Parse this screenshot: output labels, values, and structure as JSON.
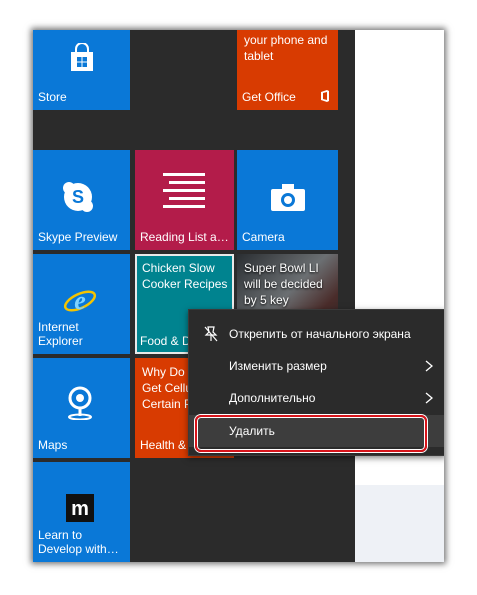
{
  "tiles": {
    "store": {
      "label": "Store",
      "icon": "store-bag-icon"
    },
    "get_office": {
      "top_text": "your phone and tablet",
      "label": "Get Office",
      "icon": "office-logo-icon"
    },
    "skype": {
      "label": "Skype Preview",
      "icon": "skype-icon"
    },
    "reading_list": {
      "label": "Reading List a…",
      "icon": "reading-list-icon"
    },
    "camera": {
      "label": "Camera",
      "icon": "camera-icon"
    },
    "ie": {
      "label": "Internet Explorer",
      "icon": "internet-explorer-icon"
    },
    "food": {
      "headline": "Chicken Slow Cooker Recipes",
      "label": "Food & D"
    },
    "news": {
      "headline": "Super Bowl LI will be decided by 5 key"
    },
    "maps": {
      "label": "Maps",
      "icon": "map-pin-icon"
    },
    "health": {
      "headline": "Why Do Only Get Cellulite Certain P",
      "label": "Health &"
    },
    "learn": {
      "label": "Learn to Develop with…",
      "icon": "m-logo-icon"
    }
  },
  "context_menu": {
    "items": [
      {
        "label": "Открепить от начального экрана",
        "icon": "unpin-icon"
      },
      {
        "label": "Изменить размер",
        "has_submenu": true
      },
      {
        "label": "Дополнительно",
        "has_submenu": true
      },
      {
        "label": "Удалить",
        "highlighted": true
      }
    ]
  },
  "colors": {
    "tile_blue": "#0a78d7",
    "tile_orange": "#d83b01",
    "tile_crimson": "#b31c4a",
    "tile_teal": "#00838f",
    "start_background": "#2b2b2b",
    "highlight_frame": "#d7141b"
  }
}
